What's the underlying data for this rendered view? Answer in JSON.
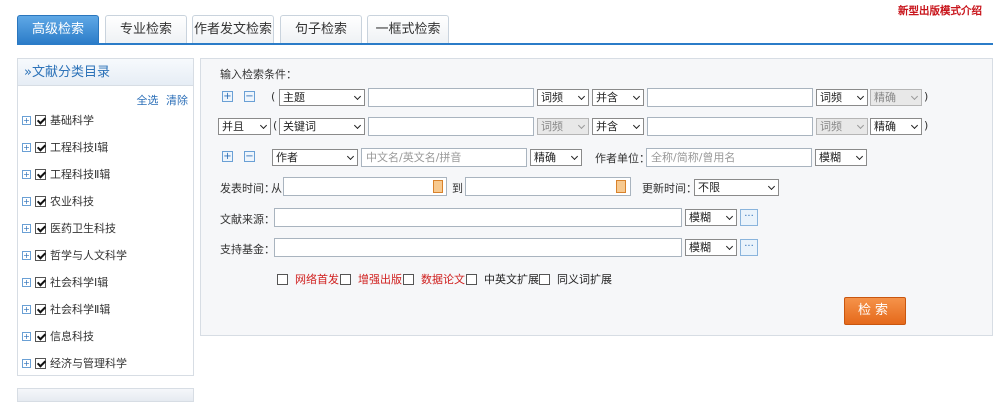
{
  "tabs": [
    "高级检索",
    "专业检索",
    "作者发文检索",
    "句子检索",
    "一框式检索"
  ],
  "promo_link": "新型出版模式介绍",
  "sidebar": {
    "title": "»文献分类目录",
    "select_all": "全选",
    "clear": "清除",
    "items": [
      {
        "label": "基础科学"
      },
      {
        "label": "工程科技Ⅰ辑"
      },
      {
        "label": "工程科技Ⅱ辑"
      },
      {
        "label": "农业科技"
      },
      {
        "label": "医药卫生科技"
      },
      {
        "label": "哲学与人文科学"
      },
      {
        "label": "社会科学Ⅰ辑"
      },
      {
        "label": "社会科学Ⅱ辑"
      },
      {
        "label": "信息科技"
      },
      {
        "label": "经济与管理科学"
      }
    ]
  },
  "form": {
    "heading": "输入检索条件：",
    "plus": "+",
    "minus": "−",
    "open_paren": "(",
    "close_paren": ")",
    "row1": {
      "field": "主题",
      "freq": "词频",
      "combine": "并含",
      "freq2": "词频",
      "match": "精确"
    },
    "row2": {
      "logic": "并且",
      "field": "关键词",
      "freq": "词频",
      "combine": "并含",
      "freq2": "词频",
      "match": "精确"
    },
    "author_row": {
      "field": "作者",
      "placeholder": "中文名/英文名/拼音",
      "match": "精确",
      "unit_label": "作者单位：",
      "unit_placeholder": "全称/简称/曾用名",
      "unit_match": "模糊"
    },
    "pub_time_label": "发表时间：",
    "from_label": "从",
    "to_label": "到",
    "update_label": "更新时间：",
    "update_value": "不限",
    "source_label": "文献来源：",
    "source_match": "模糊",
    "fund_label": "支持基金：",
    "fund_match": "模糊",
    "dots": "···",
    "options": [
      {
        "label": "网络首发",
        "color": "#d0201f"
      },
      {
        "label": "增强出版",
        "color": "#d0201f"
      },
      {
        "label": "数据论文",
        "color": "#d0201f"
      },
      {
        "label": "中英文扩展",
        "color": "#222222"
      },
      {
        "label": "同义词扩展",
        "color": "#222222"
      }
    ],
    "search_button": "检索"
  }
}
